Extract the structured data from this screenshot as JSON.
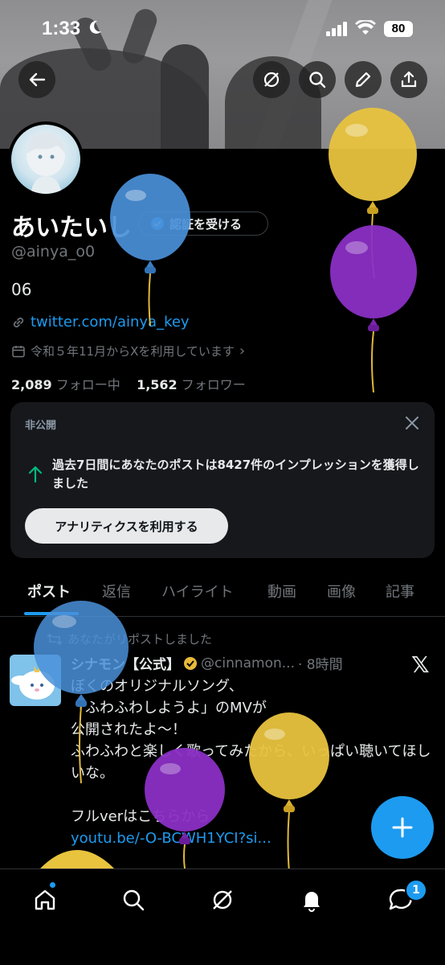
{
  "status": {
    "time": "1:33",
    "battery": "80"
  },
  "profile": {
    "name": "あいたいし",
    "verify_label": "認証を受ける",
    "handle": "@ainya_o0",
    "bio": "06",
    "link": "twitter.com/ainya_key",
    "joined": "令和５年11月からXを利用しています",
    "following_count": "2,089",
    "following_label": "フォロー中",
    "followers_count": "1,562",
    "followers_label": "フォロワー"
  },
  "card": {
    "label": "非公開",
    "message": "過去7日間にあなたのポストは8427件のインプレッションを獲得しました",
    "button": "アナリティクスを利用する"
  },
  "tabs": [
    "ポスト",
    "返信",
    "ハイライト",
    "動画",
    "画像",
    "記事"
  ],
  "post": {
    "repost_label": "あなたがリポストしました",
    "author": "シナモン【公式】",
    "author_handle": "@cinnamon...",
    "time": "· 8時間",
    "lines": [
      "ぼくのオリジナルソング、",
      "「ふわふわしようよ」のMVが",
      "公開されたよ～！",
      "ふわふわと楽しく歌ってみたから、いっぱい聴いてほしいな。",
      "",
      "フルverはこちらから"
    ],
    "link": "youtu.be/-O-BCWH1YCI?si..."
  },
  "nav": {
    "badge": "1"
  },
  "colors": {
    "accent": "#1d9bf0",
    "balloon_blue": "#4a90d9",
    "balloon_yellow": "#e8c33e",
    "balloon_purple": "#8a2fc4"
  },
  "icons": [
    "back-arrow-icon",
    "grok-icon",
    "search-icon",
    "edit-icon",
    "share-icon",
    "verified-badge-icon",
    "link-icon",
    "calendar-icon",
    "close-icon",
    "arrow-up-icon",
    "repost-icon",
    "x-logo-icon",
    "plus-icon",
    "home-icon",
    "notifications-icon",
    "messages-icon"
  ]
}
